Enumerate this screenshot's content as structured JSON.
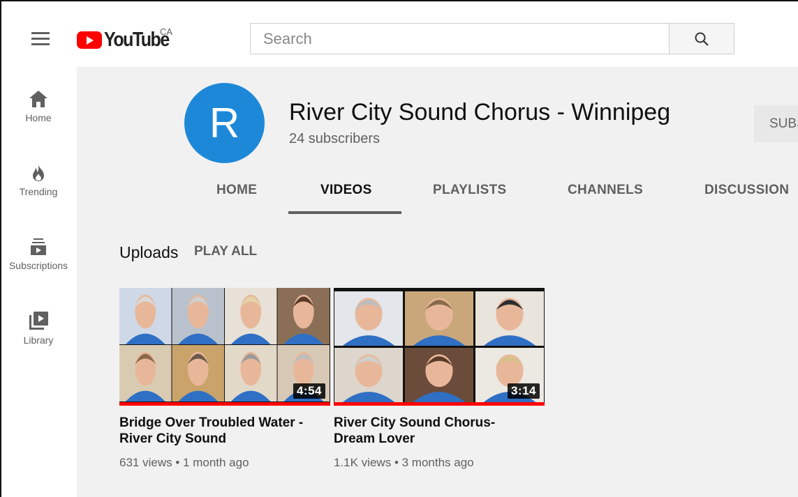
{
  "masthead": {
    "logo_text": "YouTube",
    "logo_country": "CA",
    "search_placeholder": "Search",
    "icons": {
      "menu": "hamburger-icon",
      "search": "search-icon"
    }
  },
  "sidebar": {
    "items": [
      {
        "label": "Home",
        "icon": "home-icon"
      },
      {
        "label": "Trending",
        "icon": "flame-icon"
      },
      {
        "label": "Subscriptions",
        "icon": "subscriptions-icon"
      },
      {
        "label": "Library",
        "icon": "library-icon"
      }
    ]
  },
  "channel": {
    "avatar_letter": "R",
    "name": "River City Sound Chorus - Winnipeg",
    "subscribers": "24 subscribers",
    "subscribe_label": "SUBS",
    "tabs": [
      {
        "label": "HOME",
        "active": false
      },
      {
        "label": "VIDEOS",
        "active": true
      },
      {
        "label": "PLAYLISTS",
        "active": false
      },
      {
        "label": "CHANNELS",
        "active": false
      },
      {
        "label": "DISCUSSION",
        "active": false
      }
    ],
    "avatar_color": "#1e88d8"
  },
  "uploads": {
    "title": "Uploads",
    "play_all": "PLAY ALL",
    "videos": [
      {
        "title_line1": "Bridge Over Troubled Water -",
        "title_line2": "River City Sound",
        "duration": "4:54",
        "views": "631 views",
        "separator": "•",
        "age": "1 month ago",
        "watched_fraction": 1.0
      },
      {
        "title_line1": "River City Sound Chorus-",
        "title_line2": "Dream Lover",
        "duration": "3:14",
        "views": "1.1K views",
        "separator": "•",
        "age": "3 months ago",
        "watched_fraction": 1.0
      }
    ]
  },
  "colors": {
    "brand_red": "#ff0000",
    "shirt_blue": "#2f6fc4",
    "header_bg": "#f1f1f1"
  }
}
